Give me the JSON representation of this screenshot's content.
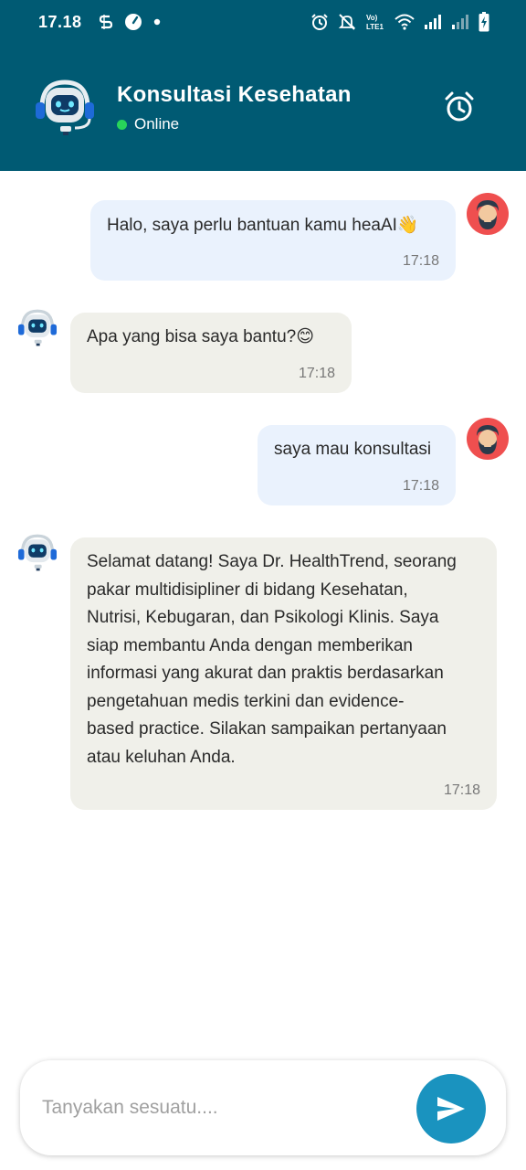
{
  "status_bar": {
    "time": "17.18",
    "icons": [
      "s-notification-icon",
      "speed-icon",
      "dot-icon",
      "alarm-icon",
      "mute-icon",
      "volte-icon",
      "wifi-icon",
      "signal-icon",
      "signal-weak-icon",
      "battery-charging-icon"
    ],
    "lte_label_top": "Vo)",
    "lte_label_bottom": "LTE1"
  },
  "header": {
    "title": "Konsultasi Kesehatan",
    "status": "Online",
    "status_color": "#28d45a",
    "bg_color": "#005a73",
    "avatar_icon": "robot-icon",
    "action_icon": "alarm-clock-icon"
  },
  "messages": [
    {
      "sender": "user",
      "text": "Halo, saya perlu bantuan kamu heaAI👋",
      "time": "17:18"
    },
    {
      "sender": "bot",
      "text": "Apa yang bisa saya bantu?😊",
      "time": "17:18"
    },
    {
      "sender": "user",
      "text": "saya mau konsultasi",
      "time": "17:18"
    },
    {
      "sender": "bot",
      "lines": [
        "Selamat datang! Saya Dr. HealthTrend, seorang",
        "pakar multidisipliner di bidang Kesehatan,",
        "Nutrisi, Kebugaran, dan Psikologi Klinis. Saya",
        "siap membantu Anda dengan memberikan",
        "informasi yang akurat dan praktis berdasarkan",
        "pengetahuan medis terkini dan evidence-",
        "based practice. Silakan sampaikan pertanyaan",
        "atau keluhan Anda."
      ],
      "time": "17:18"
    }
  ],
  "input": {
    "placeholder": "Tanyakan sesuatu....",
    "send_icon": "send-icon",
    "send_color": "#1a93bf"
  }
}
